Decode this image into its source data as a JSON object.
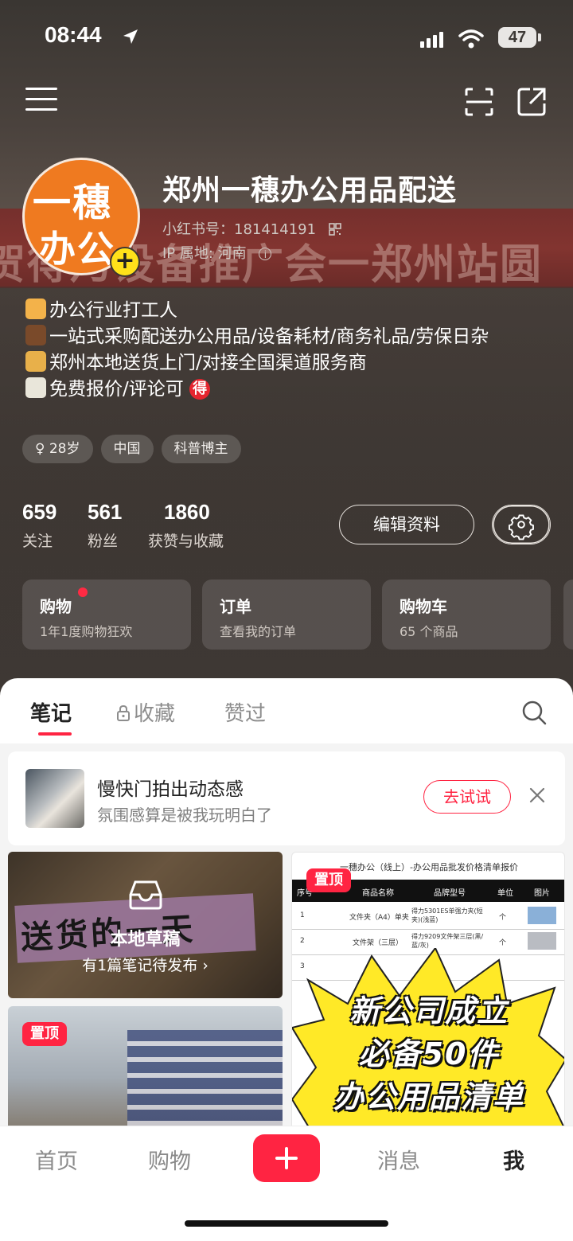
{
  "status_bar": {
    "time": "08:44",
    "battery": "47"
  },
  "profile": {
    "avatar_line1": "一穗",
    "avatar_line2": "办公",
    "name": "郑州一穗办公用品配送",
    "red_id": "小红书号：181414191",
    "ip_location": "IP 属地: 河南",
    "banner_text": "贺得乃设备推广会一郑州站圆"
  },
  "bio": [
    "办公行业打工人",
    "一站式采购配送办公用品/设备耗材/商务礼品/劳保日杂",
    "郑州本地送货上门/对接全国渠道服务商",
    "免费报价/评论可"
  ],
  "bio_badge": "得",
  "tags": [
    "♀ 28岁",
    "中国",
    "科普博主"
  ],
  "stats": {
    "following": {
      "value": "659",
      "label": "关注"
    },
    "followers": {
      "value": "561",
      "label": "粉丝"
    },
    "likes": {
      "value": "1860",
      "label": "获赞与收藏"
    }
  },
  "edit_profile_label": "编辑资料",
  "cards": [
    {
      "title": "购物",
      "sub": "1年1度购物狂欢"
    },
    {
      "title": "订单",
      "sub": "查看我的订单"
    },
    {
      "title": "购物车",
      "sub": "65 个商品"
    }
  ],
  "tabs": {
    "notes": "笔记",
    "collect": "收藏",
    "liked": "赞过"
  },
  "promo": {
    "title": "慢快门拍出动态感",
    "sub": "氛围感算是被我玩明白了",
    "button": "去试试"
  },
  "draft": {
    "image_text": "送货的一天",
    "title": "本地草稿",
    "sub": "有1篇笔记待发布 ›"
  },
  "pin_label": "置顶",
  "doc_post": {
    "title": "一穗办公（线上）-办公用品批发价格清单报价",
    "columns": [
      "序号",
      "商品名称",
      "品牌型号",
      "单位",
      "图片"
    ],
    "rows": [
      {
        "no": "1",
        "name": "文件夹（A4）单夹",
        "model": "得力5301ES单强力夹(短夹)(浅蓝)",
        "unit": "个"
      },
      {
        "no": "2",
        "name": "文件架（三层）",
        "model": "得力9209文件架三层(黑/蓝/灰)",
        "unit": "个"
      },
      {
        "no": "3",
        "name": "",
        "model": "",
        "unit": ""
      }
    ],
    "headline": [
      "新公司成立",
      "必备50件",
      "办公用品清单"
    ]
  },
  "tabbar": {
    "home": "首页",
    "shop": "购物",
    "messages": "消息",
    "me": "我"
  },
  "colors": {
    "accent": "#ff2442",
    "avatar": "#ef7a20",
    "burst": "#ffe927"
  }
}
